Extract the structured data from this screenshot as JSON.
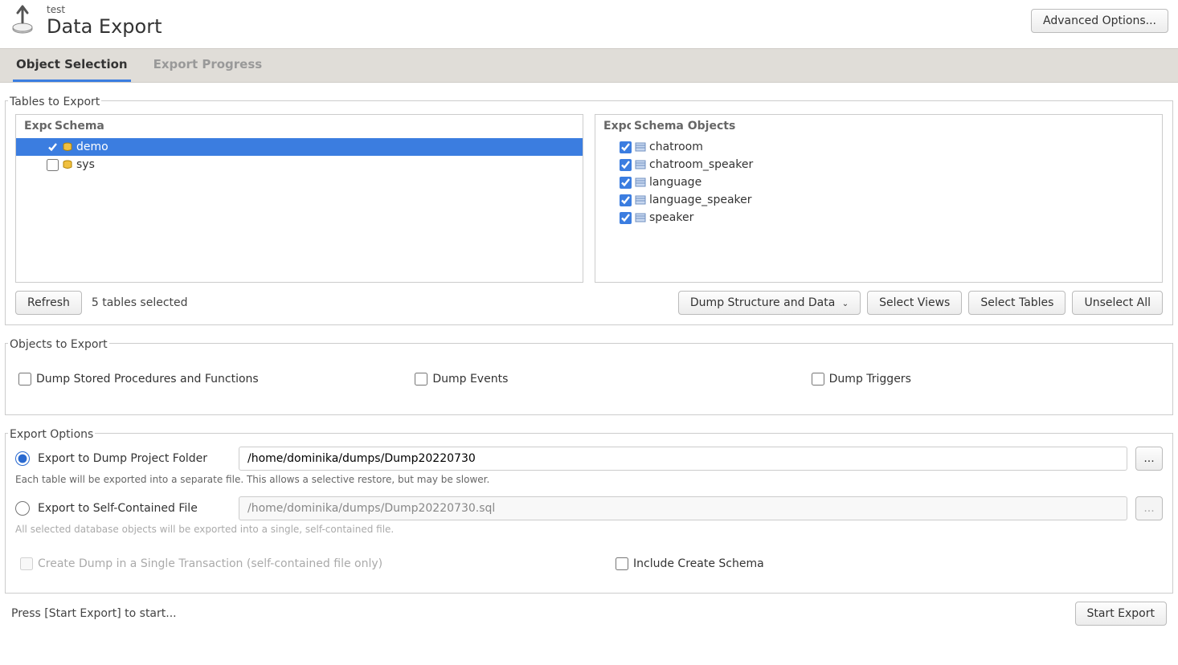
{
  "header": {
    "breadcrumb": "test",
    "title": "Data Export",
    "advanced_button": "Advanced Options..."
  },
  "tabs": [
    {
      "label": "Object Selection",
      "active": true
    },
    {
      "label": "Export Progress",
      "active": false
    }
  ],
  "tables_section": {
    "legend": "Tables to Export",
    "schema_header_col1": "Expo",
    "schema_header_col2": "Schema",
    "objects_header_col1": "Expo",
    "objects_header_col2": "Schema Objects",
    "schemas": [
      {
        "name": "demo",
        "checked": true,
        "selected": true
      },
      {
        "name": "sys",
        "checked": false,
        "selected": false
      }
    ],
    "objects": [
      {
        "name": "chatroom",
        "checked": true
      },
      {
        "name": "chatroom_speaker",
        "checked": true
      },
      {
        "name": "language",
        "checked": true
      },
      {
        "name": "language_speaker",
        "checked": true
      },
      {
        "name": "speaker",
        "checked": true
      }
    ],
    "refresh_button": "Refresh",
    "status": "5 tables selected",
    "dump_dropdown": "Dump Structure and Data",
    "select_views_button": "Select Views",
    "select_tables_button": "Select Tables",
    "unselect_all_button": "Unselect All"
  },
  "objects_section": {
    "legend": "Objects to Export",
    "options": [
      {
        "label": "Dump Stored Procedures and Functions",
        "checked": false
      },
      {
        "label": "Dump Events",
        "checked": false
      },
      {
        "label": "Dump Triggers",
        "checked": false
      }
    ]
  },
  "export_options": {
    "legend": "Export Options",
    "folder_option": {
      "label": "Export to Dump Project Folder",
      "value": "/home/dominika/dumps/Dump20220730",
      "hint": "Each table will be exported into a separate file. This allows a selective restore, but may be slower.",
      "selected": true
    },
    "file_option": {
      "label": "Export to Self-Contained File",
      "value": "/home/dominika/dumps/Dump20220730.sql",
      "hint": "All selected database objects will be exported into a single, self-contained file.",
      "selected": false
    },
    "browse_button": "...",
    "single_transaction": {
      "label": "Create Dump in a Single Transaction (self-contained file only)",
      "checked": false,
      "disabled": true
    },
    "include_schema": {
      "label": "Include Create Schema",
      "checked": false,
      "disabled": false
    }
  },
  "footer": {
    "message": "Press [Start Export] to start...",
    "start_button": "Start Export"
  }
}
